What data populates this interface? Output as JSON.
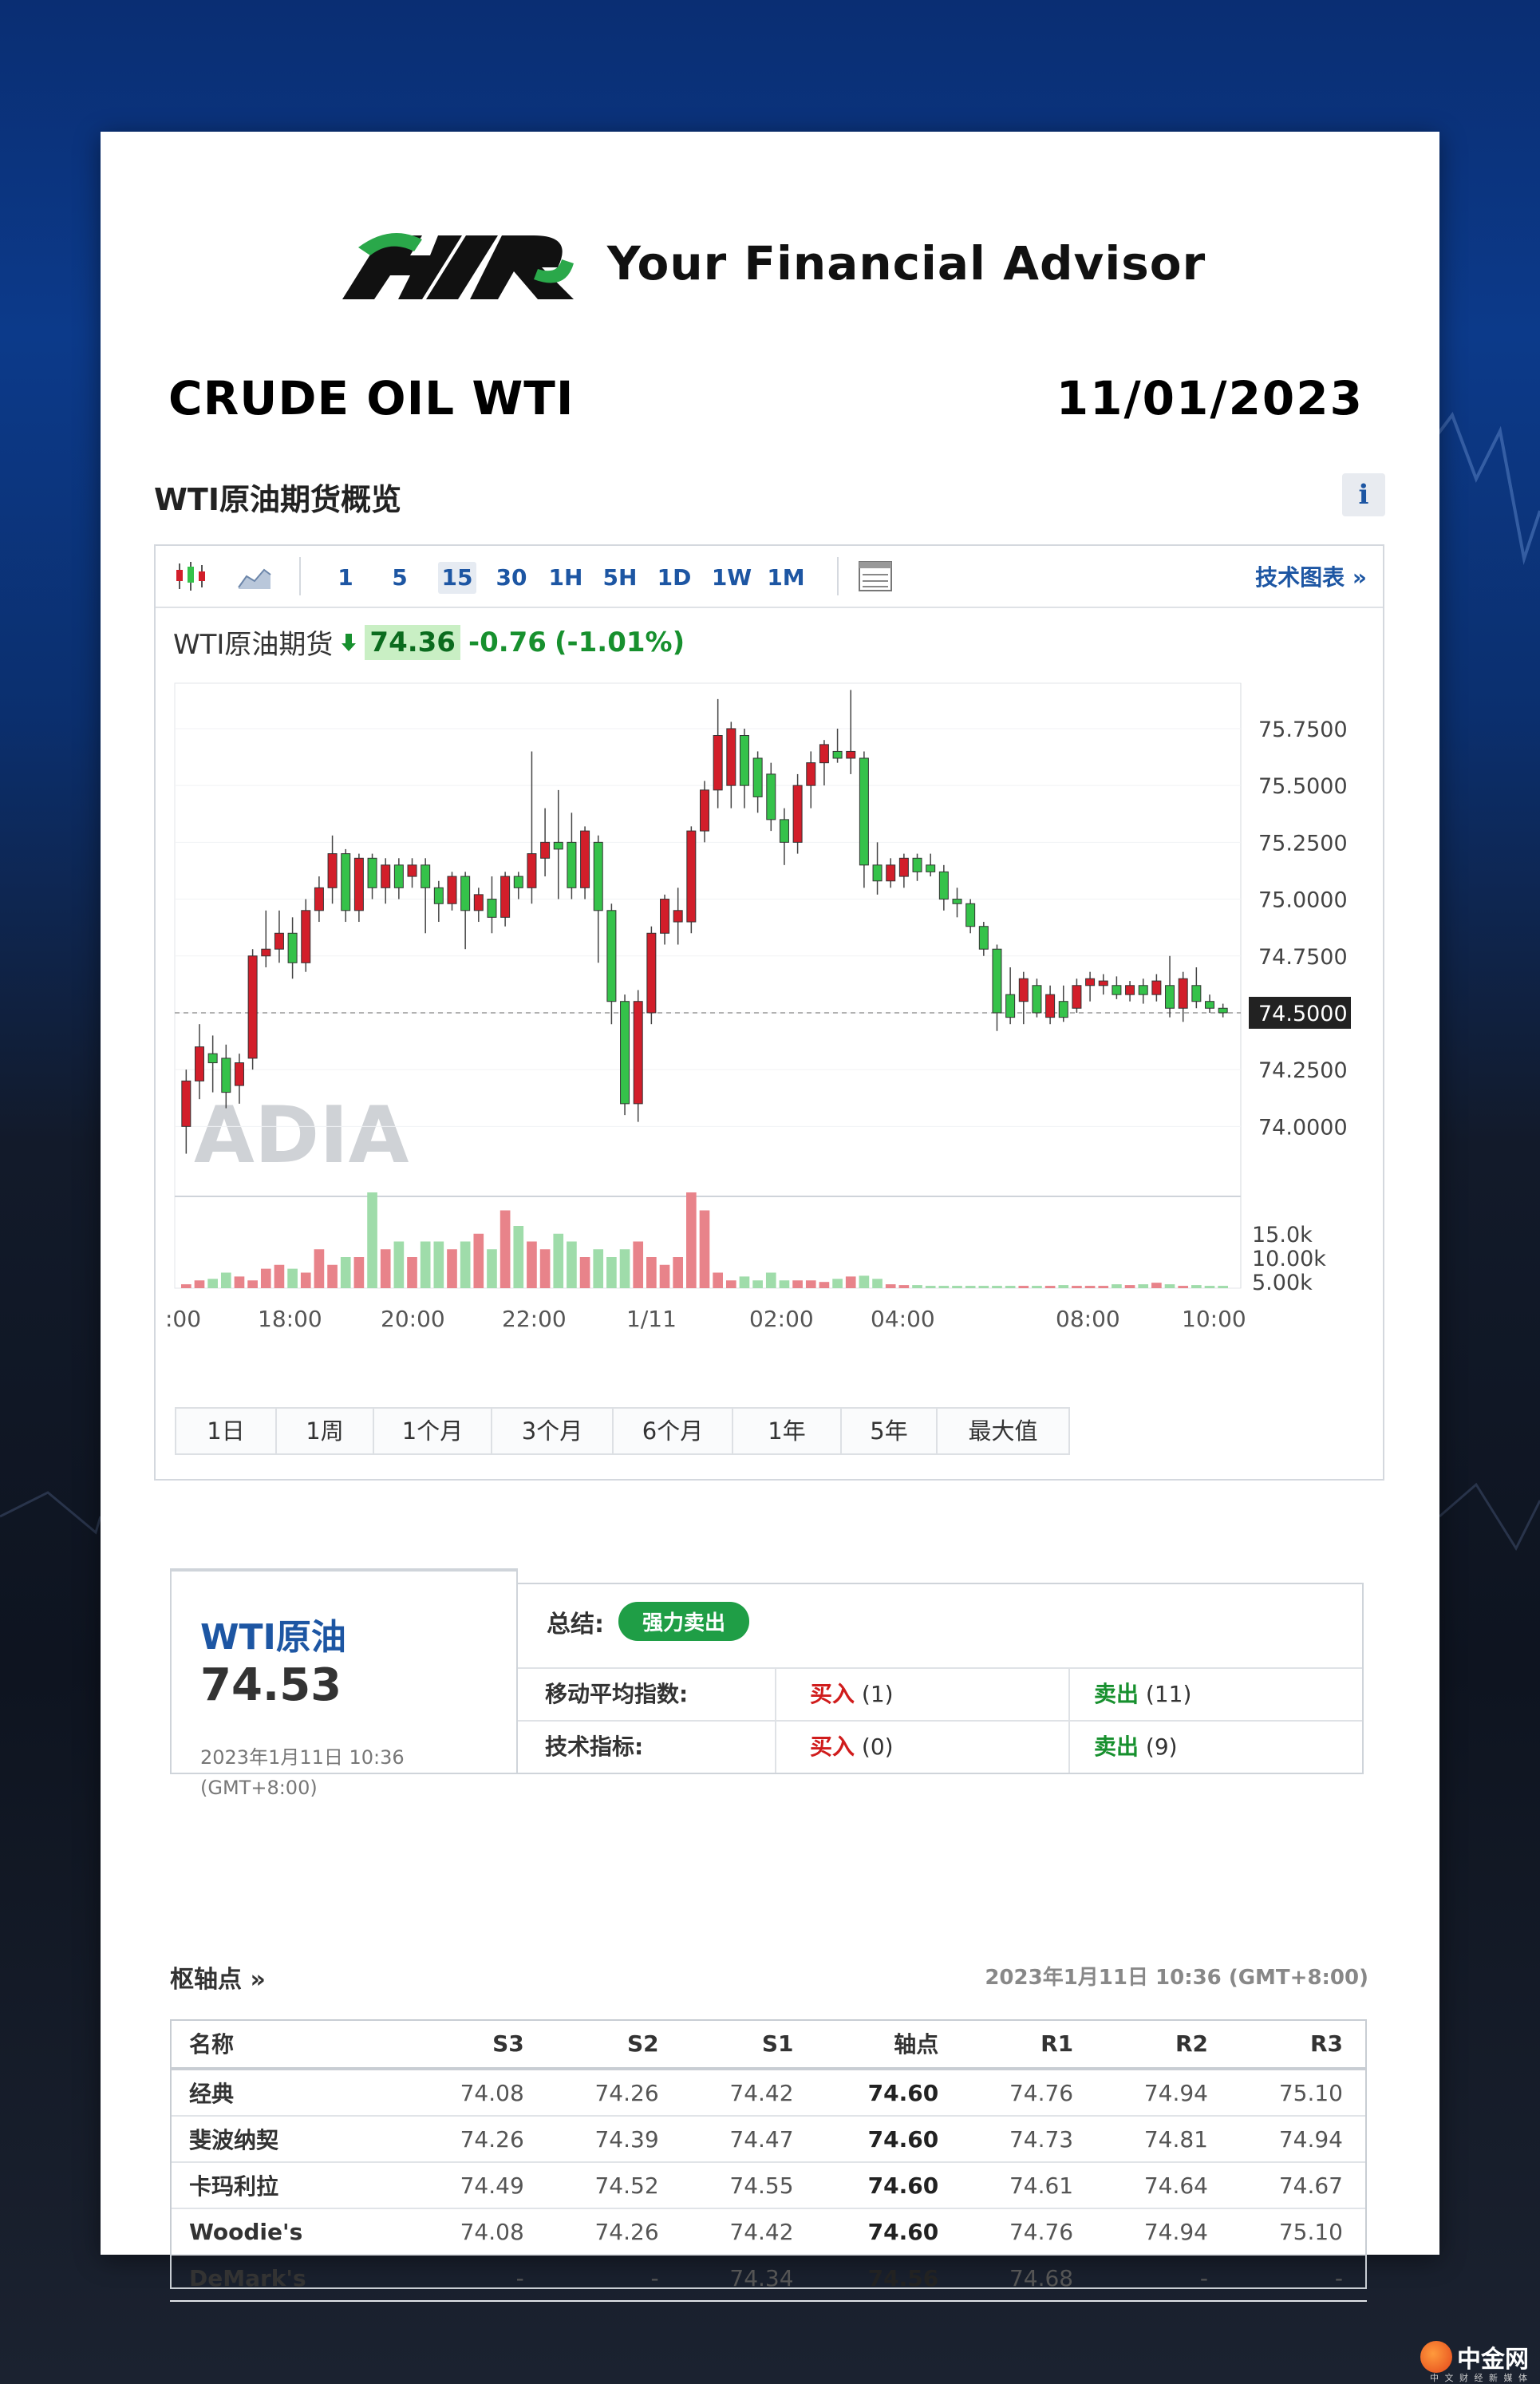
{
  "branding": {
    "tagline": "Your Financial Advisor",
    "watermark": "ADIA",
    "site_name": "中金网",
    "site_sub": "中 文 财 经 新 媒 体"
  },
  "header": {
    "title": "CRUDE OIL WTI",
    "date": "11/01/2023"
  },
  "section_title": "WTI原油期货概览",
  "info_label": "i",
  "toolbar": {
    "intervals": [
      "1",
      "5",
      "15",
      "30",
      "1H",
      "5H",
      "1D",
      "1W",
      "1M"
    ],
    "active_interval": "15",
    "tech_link": "技术图表 »"
  },
  "quote": {
    "name": "WTI原油期货",
    "price": "74.36",
    "change": "-0.76",
    "change_pct": "(-1.01%)"
  },
  "chart_data": {
    "type": "candlestick",
    "y_ticks": [
      "75.7500",
      "75.5000",
      "75.2500",
      "75.0000",
      "74.7500",
      "74.5000",
      "74.2500",
      "74.0000"
    ],
    "ylim": [
      73.78,
      75.95
    ],
    "current_price_label": "74.5000",
    "volume_ticks": [
      "15.0k",
      "10.00k",
      "5.00k"
    ],
    "x_ticks": [
      ":00",
      "18:00",
      "20:00",
      "22:00",
      "1/11",
      "02:00",
      "04:00",
      "08:00",
      "10:00"
    ],
    "candles": [
      [
        74.0,
        74.2,
        73.88,
        74.25
      ],
      [
        74.2,
        74.35,
        74.12,
        74.45
      ],
      [
        74.32,
        74.28,
        74.15,
        74.4
      ],
      [
        74.3,
        74.15,
        74.08,
        74.36
      ],
      [
        74.18,
        74.28,
        74.1,
        74.32
      ],
      [
        74.3,
        74.75,
        74.25,
        74.78
      ],
      [
        74.75,
        74.78,
        74.7,
        74.95
      ],
      [
        74.78,
        74.85,
        74.72,
        74.95
      ],
      [
        74.85,
        74.72,
        74.65,
        74.92
      ],
      [
        74.72,
        74.95,
        74.68,
        75.0
      ],
      [
        74.95,
        75.05,
        74.9,
        75.1
      ],
      [
        75.05,
        75.2,
        74.98,
        75.28
      ],
      [
        75.2,
        74.95,
        74.9,
        75.22
      ],
      [
        74.95,
        75.18,
        74.9,
        75.2
      ],
      [
        75.18,
        75.05,
        75.0,
        75.2
      ],
      [
        75.05,
        75.15,
        74.98,
        75.18
      ],
      [
        75.15,
        75.05,
        75.0,
        75.18
      ],
      [
        75.1,
        75.15,
        75.05,
        75.18
      ],
      [
        75.15,
        75.05,
        74.85,
        75.18
      ],
      [
        75.05,
        74.98,
        74.9,
        75.08
      ],
      [
        74.98,
        75.1,
        74.95,
        75.12
      ],
      [
        75.1,
        74.95,
        74.78,
        75.12
      ],
      [
        74.95,
        75.02,
        74.9,
        75.05
      ],
      [
        75.0,
        74.92,
        74.85,
        75.1
      ],
      [
        74.92,
        75.1,
        74.88,
        75.12
      ],
      [
        75.1,
        75.05,
        75.0,
        75.12
      ],
      [
        75.05,
        75.2,
        74.98,
        75.65
      ],
      [
        75.18,
        75.25,
        75.1,
        75.4
      ],
      [
        75.25,
        75.22,
        75.0,
        75.48
      ],
      [
        75.25,
        75.05,
        75.0,
        75.38
      ],
      [
        75.05,
        75.3,
        75.0,
        75.32
      ],
      [
        75.25,
        74.95,
        74.72,
        75.28
      ],
      [
        74.95,
        74.55,
        74.45,
        74.98
      ],
      [
        74.55,
        74.1,
        74.05,
        74.58
      ],
      [
        74.1,
        74.55,
        74.02,
        74.6
      ],
      [
        74.5,
        74.85,
        74.45,
        74.88
      ],
      [
        74.85,
        75.0,
        74.8,
        75.02
      ],
      [
        74.9,
        74.95,
        74.8,
        75.05
      ],
      [
        74.9,
        75.3,
        74.85,
        75.32
      ],
      [
        75.3,
        75.48,
        75.25,
        75.52
      ],
      [
        75.48,
        75.72,
        75.4,
        75.88
      ],
      [
        75.5,
        75.75,
        75.4,
        75.78
      ],
      [
        75.72,
        75.5,
        75.4,
        75.75
      ],
      [
        75.62,
        75.45,
        75.38,
        75.65
      ],
      [
        75.55,
        75.35,
        75.3,
        75.6
      ],
      [
        75.35,
        75.25,
        75.15,
        75.4
      ],
      [
        75.25,
        75.5,
        75.2,
        75.55
      ],
      [
        75.5,
        75.6,
        75.4,
        75.65
      ],
      [
        75.6,
        75.68,
        75.5,
        75.7
      ],
      [
        75.65,
        75.62,
        75.6,
        75.75
      ],
      [
        75.62,
        75.65,
        75.55,
        75.92
      ],
      [
        75.62,
        75.15,
        75.05,
        75.65
      ],
      [
        75.15,
        75.08,
        75.02,
        75.25
      ],
      [
        75.08,
        75.15,
        75.05,
        75.18
      ],
      [
        75.1,
        75.18,
        75.05,
        75.2
      ],
      [
        75.18,
        75.12,
        75.08,
        75.2
      ],
      [
        75.15,
        75.12,
        75.1,
        75.2
      ],
      [
        75.12,
        75.0,
        74.95,
        75.15
      ],
      [
        75.0,
        74.98,
        74.92,
        75.05
      ],
      [
        74.98,
        74.88,
        74.85,
        75.0
      ],
      [
        74.88,
        74.78,
        74.75,
        74.9
      ],
      [
        74.78,
        74.5,
        74.42,
        74.8
      ],
      [
        74.58,
        74.48,
        74.45,
        74.7
      ],
      [
        74.55,
        74.65,
        74.45,
        74.68
      ],
      [
        74.62,
        74.5,
        74.48,
        74.65
      ],
      [
        74.48,
        74.58,
        74.45,
        74.62
      ],
      [
        74.55,
        74.48,
        74.46,
        74.62
      ],
      [
        74.52,
        74.62,
        74.5,
        74.65
      ],
      [
        74.62,
        74.65,
        74.55,
        74.68
      ],
      [
        74.62,
        74.64,
        74.58,
        74.67
      ],
      [
        74.62,
        74.58,
        74.56,
        74.66
      ],
      [
        74.58,
        74.62,
        74.55,
        74.64
      ],
      [
        74.62,
        74.58,
        74.54,
        74.65
      ],
      [
        74.58,
        74.64,
        74.55,
        74.67
      ],
      [
        74.62,
        74.52,
        74.48,
        74.75
      ],
      [
        74.52,
        74.65,
        74.46,
        74.68
      ],
      [
        74.62,
        74.55,
        74.52,
        74.7
      ],
      [
        74.55,
        74.52,
        74.5,
        74.58
      ],
      [
        74.52,
        74.5,
        74.48,
        74.54
      ]
    ],
    "volumes_k": [
      0.5,
      1,
      1.2,
      2,
      1.5,
      1,
      2.5,
      3,
      2.5,
      2,
      5,
      3,
      4,
      4,
      15,
      5,
      6,
      4,
      6,
      6,
      5,
      6,
      7,
      5,
      10,
      8,
      6,
      5,
      7,
      6,
      4,
      5,
      4,
      5,
      6,
      4,
      3,
      4,
      15,
      10,
      2,
      1,
      1.5,
      1,
      2,
      1,
      1,
      1,
      0.8,
      1.2,
      1.5,
      1.6,
      1.2,
      0.5,
      0.4,
      0.4,
      0.3,
      0.3,
      0.3,
      0.3,
      0.3,
      0.3,
      0.3,
      0.3,
      0.3,
      0.3,
      0.4,
      0.3,
      0.3,
      0.3,
      0.5,
      0.4,
      0.5,
      0.7,
      0.5,
      0.3,
      0.4,
      0.3,
      0.3
    ]
  },
  "ranges": [
    "1日",
    "1周",
    "1个月",
    "3个月",
    "6个月",
    "1年",
    "5年",
    "最大值"
  ],
  "summary": {
    "name": "WTI原油",
    "price": "74.53",
    "time": "2023年1月11日 10:36 (GMT+8:00)",
    "head_label": "总结:",
    "verdict": "强力卖出",
    "rows": [
      {
        "label": "移动平均指数:",
        "buy": "买入",
        "buy_count": "(1)",
        "sell": "卖出",
        "sell_count": "(11)"
      },
      {
        "label": "技术指标:",
        "buy": "买入",
        "buy_count": "(0)",
        "sell": "卖出",
        "sell_count": "(9)"
      }
    ]
  },
  "pivots": {
    "title": "枢轴点 »",
    "time": "2023年1月11日 10:36 (GMT+8:00)",
    "columns": [
      "名称",
      "S3",
      "S2",
      "S1",
      "轴点",
      "R1",
      "R2",
      "R3"
    ],
    "rows": [
      [
        "经典",
        "74.08",
        "74.26",
        "74.42",
        "74.60",
        "74.76",
        "74.94",
        "75.10"
      ],
      [
        "斐波纳契",
        "74.26",
        "74.39",
        "74.47",
        "74.60",
        "74.73",
        "74.81",
        "74.94"
      ],
      [
        "卡玛利拉",
        "74.49",
        "74.52",
        "74.55",
        "74.60",
        "74.61",
        "74.64",
        "74.67"
      ],
      [
        "Woodie's",
        "74.08",
        "74.26",
        "74.42",
        "74.60",
        "74.76",
        "74.94",
        "75.10"
      ],
      [
        "DeMark's",
        "-",
        "-",
        "74.34",
        "74.56",
        "74.68",
        "-",
        "-"
      ]
    ]
  },
  "colors": {
    "up": "#d21e2a",
    "down": "#35c24a",
    "accent": "#1d56a3",
    "verdict": "#1f9e46"
  }
}
